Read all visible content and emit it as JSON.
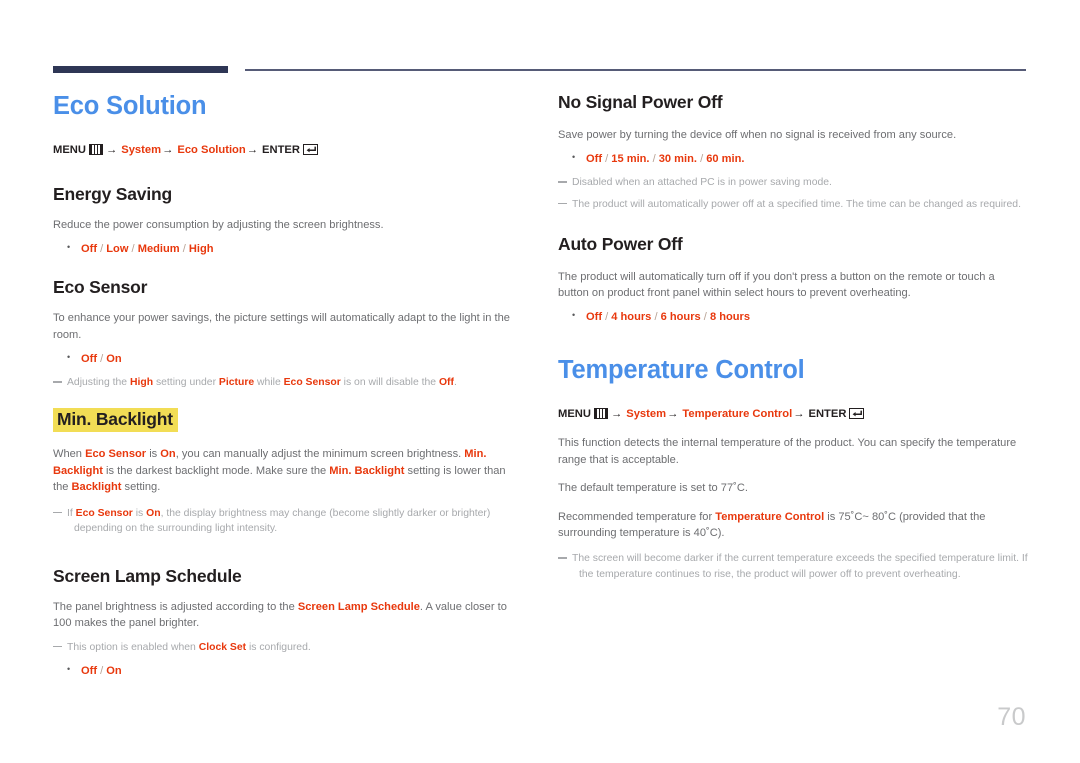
{
  "page": {
    "number": "70"
  },
  "icons": {
    "menu": "menu-grid-icon",
    "enter": "enter-return-icon"
  },
  "left_column": {
    "section_title": "Eco Solution",
    "menu_path": {
      "menu_label": "MENU",
      "arrow": "→",
      "step1": "System",
      "step2": "Eco Solution",
      "enter_label": "ENTER"
    },
    "topics": [
      {
        "heading": "Energy Saving",
        "highlight": false,
        "body": [
          "Reduce the power consumption by adjusting the screen brightness."
        ],
        "options": [
          "Off",
          "Low",
          "Medium",
          "High"
        ],
        "notes": []
      },
      {
        "heading": "Eco Sensor",
        "highlight": false,
        "body": [
          "To enhance your power savings, the picture settings will automatically adapt to the light in the room."
        ],
        "options": [
          "Off",
          "On"
        ],
        "notes": [
          "Adjusting the High setting under Picture while Eco Sensor is on will disable the Off."
        ]
      },
      {
        "heading": "Min. Backlight",
        "highlight": true,
        "body": [
          "When Eco Sensor is On, you can manually adjust the minimum screen brightness. Min. Backlight is the darkest backlight mode. Make sure the Min. Backlight setting is lower than the Backlight setting."
        ],
        "options": [],
        "notes": [
          "If Eco Sensor is On, the display brightness may change (become slightly darker or brighter) depending on the surrounding light intensity."
        ]
      },
      {
        "heading": "Screen Lamp Schedule",
        "highlight": false,
        "body": [
          "The panel brightness is adjusted according to the Screen Lamp Schedule. A value closer to 100 makes the panel brighter."
        ],
        "options": [
          "Off",
          "On"
        ],
        "notes": [
          "This option is enabled when Clock Set is configured."
        ]
      }
    ]
  },
  "right_column": {
    "topics_top": [
      {
        "heading": "No Signal Power Off",
        "body": [
          "Save power by turning the device off when no signal is received from any source."
        ],
        "options": [
          "Off",
          "15 min.",
          "30 min.",
          "60 min."
        ],
        "notes": [
          "Disabled when an attached PC is in power saving mode.",
          "The product will automatically power off at a specified time. The time can be changed as required."
        ]
      },
      {
        "heading": "Auto Power Off",
        "body": [
          "The product will automatically turn off if you don't press a button on the remote or touch a button on product front panel within select hours to prevent overheating."
        ],
        "options": [
          "Off",
          "4 hours",
          "6 hours",
          "8 hours"
        ],
        "notes": []
      }
    ],
    "section_title": "Temperature Control",
    "menu_path": {
      "menu_label": "MENU",
      "arrow": "→",
      "step1": "System",
      "step2": "Temperature Control",
      "enter_label": "ENTER"
    },
    "paragraphs": [
      "This function detects the internal temperature of the product. You can specify the temperature range that is acceptable.",
      "The default temperature is set to 77˚C.",
      "Recommended temperature for Temperature Control is 75˚C~ 80˚C (provided that the surrounding temperature is 40˚C)."
    ],
    "notes": [
      "The screen will become darker if the current temperature exceeds the specified temperature limit. If the temperature continues to rise, the product will power off to prevent overheating."
    ]
  },
  "colors": {
    "heading_blue": "#4a8fe8",
    "keyword_red": "#e8380d",
    "rule_navy": "#2e3655",
    "highlight_yellow": "#f2dd55",
    "body_gray": "#6d6e71",
    "note_gray": "#a7a9ac",
    "page_number_gray": "#c9cacb"
  }
}
